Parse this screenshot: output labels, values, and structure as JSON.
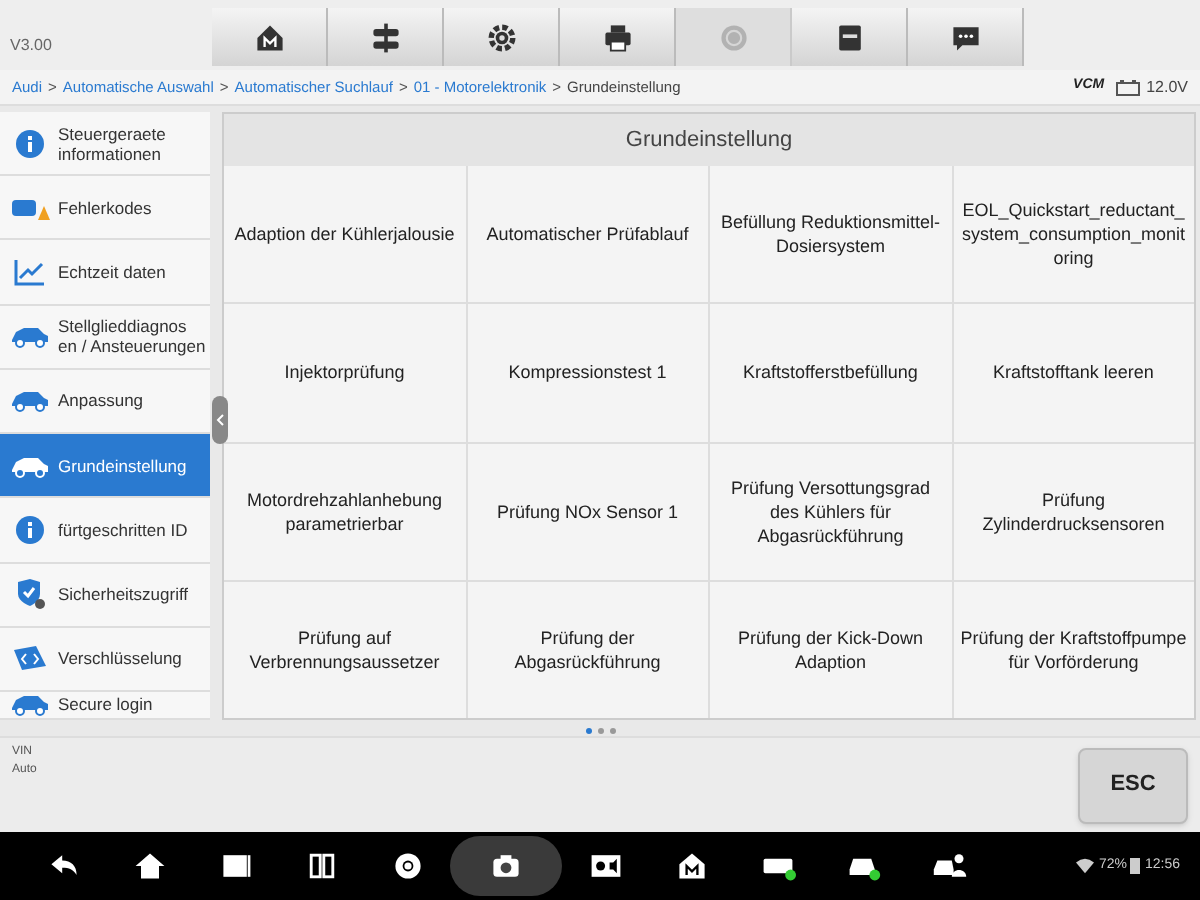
{
  "version": "V3.00",
  "toolbar": [
    {
      "kind": "home",
      "disabled": false
    },
    {
      "kind": "vehicle",
      "disabled": false
    },
    {
      "kind": "settings",
      "disabled": false
    },
    {
      "kind": "print",
      "disabled": false
    },
    {
      "kind": "help",
      "disabled": true
    },
    {
      "kind": "save",
      "disabled": false
    },
    {
      "kind": "message",
      "disabled": false
    }
  ],
  "breadcrumb_separator": ">",
  "breadcrumb": [
    {
      "label": "Audi",
      "current": false
    },
    {
      "label": "Automatische Auswahl",
      "current": false
    },
    {
      "label": "Automatischer Suchlauf",
      "current": false
    },
    {
      "label": "01 - Motorelektronik",
      "current": false
    },
    {
      "label": "Grundeinstellung",
      "current": true
    }
  ],
  "status": {
    "vcm": "VCM",
    "voltage": "12.0V"
  },
  "sidebar": [
    {
      "label": "Steuergeraete informationen",
      "kind": "info",
      "selected": false
    },
    {
      "label": "Fehlerkodes",
      "kind": "engine",
      "selected": false
    },
    {
      "label": "Echtzeit daten",
      "kind": "chart",
      "selected": false
    },
    {
      "label": "Stellglieddiagnos en / Ansteuerungen",
      "kind": "car",
      "selected": false
    },
    {
      "label": "Anpassung",
      "kind": "car",
      "selected": false
    },
    {
      "label": "Grundeinstellung",
      "kind": "car",
      "selected": true
    },
    {
      "label": "fürtgeschritten ID",
      "kind": "info",
      "selected": false
    },
    {
      "label": "Sicherheitszugriff",
      "kind": "shield",
      "selected": false
    },
    {
      "label": "Verschlüsselung",
      "kind": "code",
      "selected": false
    },
    {
      "label": "Secure login",
      "kind": "car",
      "selected": false
    }
  ],
  "panel": {
    "title": "Grundeinstellung",
    "functions": [
      "Adaption der Kühlerjalousie",
      "Automatischer Prüfablauf",
      "Befüllung Reduktionsmittel-Dosiersystem",
      "EOL_Quickstart_reductant_system_consumption_monitoring",
      "Injektorprüfung",
      "Kompressionstest 1",
      "Kraftstofferstbefüllung",
      "Kraftstofftank leeren",
      "Motordrehzahlanhebung parametrierbar",
      "Prüfung NOx Sensor 1",
      "Prüfung Versottungsgrad des Kühlers für Abgasrückführung",
      "Prüfung Zylinderdrucksensoren",
      "Prüfung auf Verbrennungsaussetzer",
      "Prüfung der Abgasrückführung",
      "Prüfung der Kick-Down Adaption",
      "Prüfung der Kraftstoffpumpe für Vorförderung"
    ],
    "pages": [
      {
        "selected": true
      },
      {
        "selected": false
      },
      {
        "selected": false
      }
    ]
  },
  "footer": {
    "vin_label": "VIN",
    "vin_value": "Auto",
    "esc": "ESC"
  },
  "navbar": {
    "icons": [
      {
        "kind": "back"
      },
      {
        "kind": "home"
      },
      {
        "kind": "recent"
      },
      {
        "kind": "split"
      },
      {
        "kind": "browser"
      },
      {
        "kind": "camera"
      },
      {
        "kind": "display"
      },
      {
        "kind": "maxi"
      },
      {
        "kind": "vcmi"
      },
      {
        "kind": "car"
      },
      {
        "kind": "person"
      }
    ],
    "battery": "72%",
    "time": "12:56"
  }
}
